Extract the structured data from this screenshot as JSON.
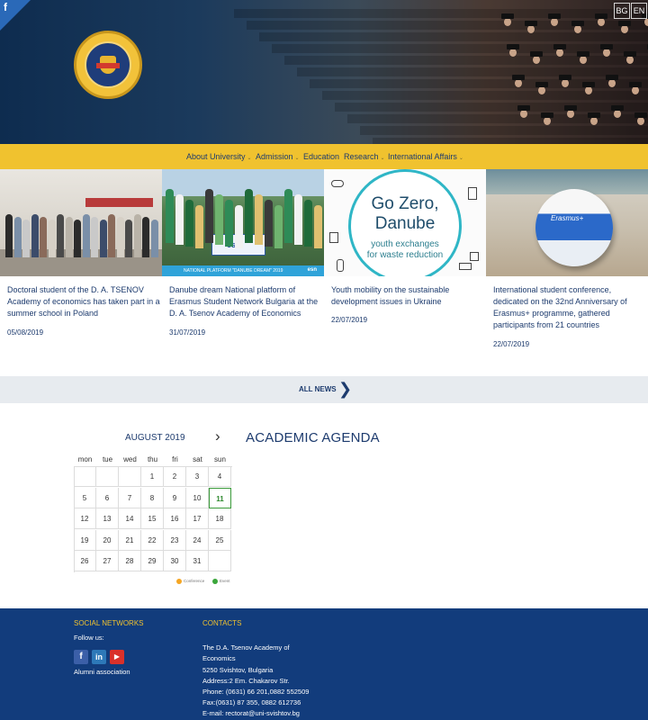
{
  "header": {
    "facebook_corner": "f",
    "languages": [
      "BG",
      "EN"
    ],
    "logo_icon": "university-seal-icon"
  },
  "nav": {
    "items": [
      {
        "label": "About University",
        "has_dropdown": true
      },
      {
        "label": "Admission",
        "has_dropdown": true
      },
      {
        "label": "Education",
        "has_dropdown": false
      },
      {
        "label": "Research",
        "has_dropdown": true
      },
      {
        "label": "International Affairs",
        "has_dropdown": true
      }
    ],
    "caret": "⌄"
  },
  "news": [
    {
      "title": "Doctoral student of the D. A. TSENOV Academy of economics has taken part in a summer school in Poland",
      "date": "05/08/2019"
    },
    {
      "title": "Danube dream National platform of Erasmus Student Network Bulgaria at the D. A. Tsenov Academy of Economics",
      "date": "31/07/2019"
    },
    {
      "title": "Youth mobility on the sustainable development issues in Ukraine",
      "date": "22/07/2019"
    },
    {
      "title": "International student conference, dedicated on the 32nd Anniversary of Erasmus+ programme, gathered participants from 21 countries",
      "date": "22/07/2019"
    }
  ],
  "news_images": {
    "esn_label": "esn",
    "esn_bar_left": "NATIONAL PLATFORM \"DANUBE DREAM\" 2019",
    "esn_bar_right": "esn",
    "gz_line1": "Go Zero,",
    "gz_line2": "Danube",
    "gz_sub1": "youth exchanges",
    "gz_sub2": "for waste reduction",
    "ball_text": "Erasmus+"
  },
  "all_news": {
    "label": "ALL NEWS",
    "arrow": "❯"
  },
  "calendar": {
    "month": "AUGUST 2019",
    "next_arrow": "›",
    "weekdays": [
      "mon",
      "tue",
      "wed",
      "thu",
      "fri",
      "sat",
      "sun"
    ],
    "weeks": [
      [
        "",
        "",
        "",
        "1",
        "2",
        "3",
        "4"
      ],
      [
        "5",
        "6",
        "7",
        "8",
        "9",
        "10",
        "11"
      ],
      [
        "12",
        "13",
        "14",
        "15",
        "16",
        "17",
        "18"
      ],
      [
        "19",
        "20",
        "21",
        "22",
        "23",
        "24",
        "25"
      ],
      [
        "26",
        "27",
        "28",
        "29",
        "30",
        "31",
        ""
      ]
    ],
    "today": "11",
    "legend": [
      {
        "label": "Conference",
        "color": "#f5a623"
      },
      {
        "label": "Event",
        "color": "#3aa63a"
      }
    ]
  },
  "agenda": {
    "title": "ACADEMIC AGENDA"
  },
  "footer": {
    "social_heading": "SOCIAL NETWORKS",
    "follow": "Follow us:",
    "social_icons": [
      "facebook-icon",
      "linkedin-icon",
      "youtube-icon"
    ],
    "alumni": "Alumni association",
    "contacts_heading": "CONTACTS",
    "contact_lines": [
      "The D.A. Tsenov Academy of",
      "Economics",
      "5250 Svishtov, Bulgaria",
      "Address:2 Em. Chakarov Str.",
      "Phone: (0631) 66 201,0882 552509",
      "Fax:(0631) 87 355, 0882 612736",
      "E-mail: rectorat@uni-svishtov.bg"
    ]
  },
  "colors": {
    "nav": "#f0c22f",
    "brand_blue": "#1d3b6e",
    "footer": "#123c7c",
    "today": "#3a9a3a"
  }
}
